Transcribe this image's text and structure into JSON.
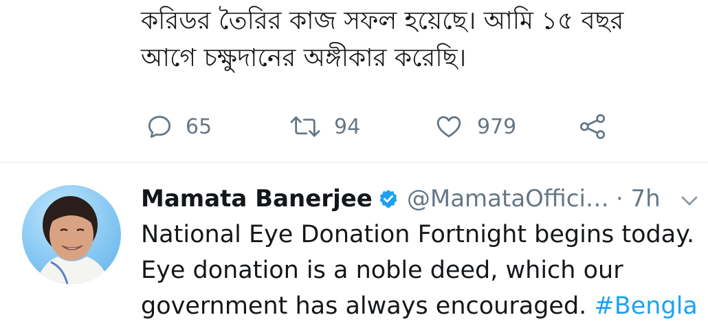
{
  "tweet_top": {
    "text_lines": [
      "করিডর তৈরির কাজ সফল হয়েছে। আমি ১৫ বছর",
      "আগে চক্ষুদানের অঙ্গীকার করেছি।"
    ],
    "actions": {
      "replies": "65",
      "retweets": "94",
      "likes": "979"
    },
    "icons": [
      "reply-icon",
      "retweet-icon",
      "like-icon",
      "share-icon"
    ]
  },
  "tweet": {
    "display_name": "Mamata Banerjee",
    "handle": "@MamataOffici…",
    "time": "· 7h",
    "text_lines": [
      "National Eye Donation Fortnight begins today.",
      "Eye donation is a noble deed, which our"
    ],
    "partial_line": "government has always encouraged.",
    "partial_hashtag": " #Bengla"
  },
  "colors": {
    "text": "#14171a",
    "muted": "#657786",
    "accent": "#1da1f2",
    "divider": "#e6ecf0"
  }
}
